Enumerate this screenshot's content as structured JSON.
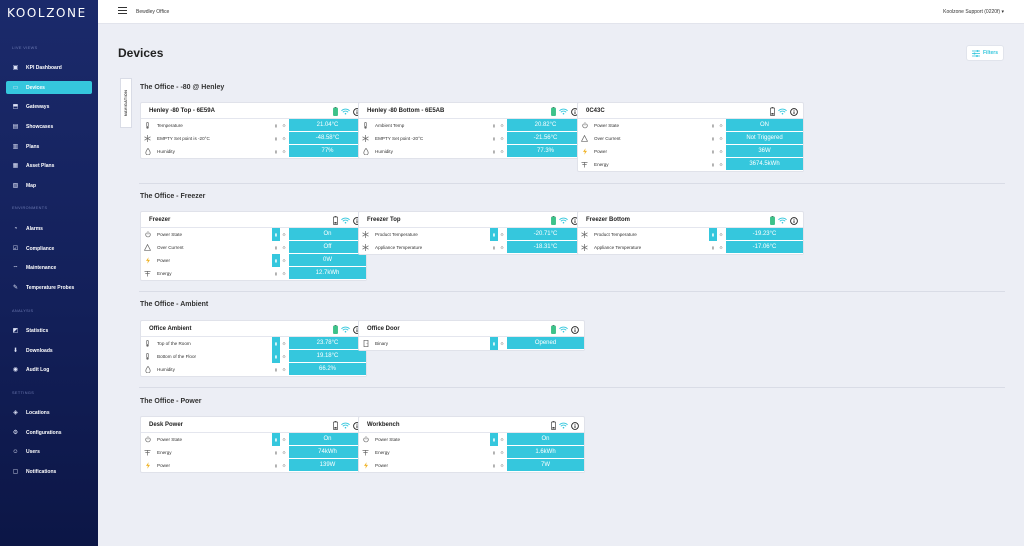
{
  "app": {
    "logo": "KOOLZONE"
  },
  "topbar": {
    "breadcrumb": "Bewdley Office",
    "user": "Koolzone Support (0220f)",
    "user_caret": "▾"
  },
  "sidebar": {
    "sections": {
      "live_views": "LIVE VIEWS",
      "environments": "ENVIRONMENTS",
      "analysis": "ANALYSIS",
      "settings": "SETTINGS"
    },
    "items": [
      {
        "label": "KPI Dashboard",
        "icon": "kpi-dashboard-icon",
        "glyph": "▣"
      },
      {
        "label": "Devices",
        "icon": "devices-icon",
        "glyph": "▭"
      },
      {
        "label": "Gateways",
        "icon": "gateway-icon",
        "glyph": "⬒"
      },
      {
        "label": "Showcases",
        "icon": "showcase-icon",
        "glyph": "▤"
      },
      {
        "label": "Plans",
        "icon": "plans-icon",
        "glyph": "▥"
      },
      {
        "label": "Asset Plans",
        "icon": "asset-plans-icon",
        "glyph": "▦"
      },
      {
        "label": "Map",
        "icon": "map-icon",
        "glyph": "▧"
      },
      {
        "label": "Alarms",
        "icon": "alarm-icon",
        "glyph": "◔"
      },
      {
        "label": "Compliance",
        "icon": "compliance-icon",
        "glyph": "☑"
      },
      {
        "label": "Maintenance",
        "icon": "maintenance-icon",
        "glyph": "⌔"
      },
      {
        "label": "Temperature Probes",
        "icon": "probe-icon",
        "glyph": "✎"
      },
      {
        "label": "Statistics",
        "icon": "statistics-icon",
        "glyph": "◩"
      },
      {
        "label": "Downloads",
        "icon": "download-icon",
        "glyph": "⬇"
      },
      {
        "label": "Audit Log",
        "icon": "audit-log-icon",
        "glyph": "◉"
      },
      {
        "label": "Locations",
        "icon": "location-icon",
        "glyph": "◈"
      },
      {
        "label": "Configurations",
        "icon": "configuration-icon",
        "glyph": "⚙"
      },
      {
        "label": "Users",
        "icon": "users-icon",
        "glyph": "☺"
      },
      {
        "label": "Notifications",
        "icon": "notification-icon",
        "glyph": "▢"
      }
    ]
  },
  "page": {
    "title": "Devices",
    "filters_label": "Filters",
    "navigation_tab": "NAVIGATION"
  },
  "groups": [
    {
      "title": "The Office - -80 @ Henley",
      "cards": [
        {
          "name": "Henley -80 Top - 6E59A",
          "battery": "full",
          "rows": [
            {
              "icon": "thermometer-icon",
              "label": "Temperature",
              "value": "21.04°C",
              "highlight": false
            },
            {
              "icon": "snowflake-icon",
              "label": "EMPTY Set point is -20°C",
              "value": "-48.58°C",
              "highlight": false
            },
            {
              "icon": "humidity-icon",
              "label": "Humidity",
              "value": "77%",
              "highlight": false
            }
          ]
        },
        {
          "name": "Henley -80 Bottom - 6E5AB",
          "battery": "full",
          "rows": [
            {
              "icon": "thermometer-icon",
              "label": "Ambient Temp",
              "value": "20.82°C",
              "highlight": false
            },
            {
              "icon": "snowflake-icon",
              "label": "EMPTY Set point -20°C",
              "value": "-21.56°C",
              "highlight": false
            },
            {
              "icon": "humidity-icon",
              "label": "Humidity",
              "value": "77.3%",
              "highlight": false
            }
          ]
        },
        {
          "name": "0C43C",
          "battery": "low",
          "rows": [
            {
              "icon": "power-state-icon",
              "label": "Power State",
              "value": "ON",
              "highlight": false
            },
            {
              "icon": "over-current-icon",
              "label": "Over Current",
              "value": "Not Triggered",
              "highlight": false
            },
            {
              "icon": "power-icon",
              "label": "Power",
              "value": "36W",
              "highlight": false
            },
            {
              "icon": "energy-icon",
              "label": "Energy",
              "value": "3674.5kWh",
              "highlight": false
            }
          ]
        }
      ]
    },
    {
      "title": "The Office - Freezer",
      "cards": [
        {
          "name": "Freezer",
          "battery": "low",
          "rows": [
            {
              "icon": "power-state-icon",
              "label": "Power State",
              "value": "On",
              "highlight": true
            },
            {
              "icon": "over-current-icon",
              "label": "Over Current",
              "value": "Off",
              "highlight": false
            },
            {
              "icon": "power-icon",
              "label": "Power",
              "value": "0W",
              "highlight": true
            },
            {
              "icon": "energy-icon",
              "label": "Energy",
              "value": "12.7kWh",
              "highlight": false
            }
          ]
        },
        {
          "name": "Freezer Top",
          "battery": "full",
          "rows": [
            {
              "icon": "snowflake-icon",
              "label": "Product Temperature",
              "value": "-20.71°C",
              "highlight": true
            },
            {
              "icon": "snowflake-icon",
              "label": "Appliance Temperature",
              "value": "-18.31°C",
              "highlight": false
            }
          ]
        },
        {
          "name": "Freezer Bottom",
          "battery": "full",
          "rows": [
            {
              "icon": "snowflake-icon",
              "label": "Product Temperature",
              "value": "-19.23°C",
              "highlight": true
            },
            {
              "icon": "snowflake-icon",
              "label": "Appliance Temperature",
              "value": "-17.06°C",
              "highlight": false
            }
          ]
        }
      ]
    },
    {
      "title": "The Office - Ambient",
      "cards": [
        {
          "name": "Office Ambient",
          "battery": "full",
          "rows": [
            {
              "icon": "thermometer-icon",
              "label": "Top of the Room",
              "value": "23.78°C",
              "highlight": true
            },
            {
              "icon": "thermometer-icon",
              "label": "Bottom of the Floor",
              "value": "19.18°C",
              "highlight": true
            },
            {
              "icon": "humidity-icon",
              "label": "Humidity",
              "value": "66.2%",
              "highlight": false
            }
          ]
        },
        {
          "name": "Office Door",
          "battery": "full",
          "rows": [
            {
              "icon": "door-icon",
              "label": "Binary",
              "value": "Opened",
              "highlight": true
            }
          ]
        }
      ]
    },
    {
      "title": "The Office - Power",
      "cards": [
        {
          "name": "Desk Power",
          "battery": "low",
          "rows": [
            {
              "icon": "power-state-icon",
              "label": "Power State",
              "value": "On",
              "highlight": true
            },
            {
              "icon": "energy-icon",
              "label": "Energy",
              "value": "74kWh",
              "highlight": false
            },
            {
              "icon": "power-icon",
              "label": "Power",
              "value": "139W",
              "highlight": false
            }
          ]
        },
        {
          "name": "Workbench",
          "battery": "low",
          "rows": [
            {
              "icon": "power-state-icon",
              "label": "Power State",
              "value": "On",
              "highlight": true
            },
            {
              "icon": "energy-icon",
              "label": "Energy",
              "value": "1.6kWh",
              "highlight": false
            },
            {
              "icon": "power-icon",
              "label": "Power",
              "value": "7W",
              "highlight": false
            }
          ]
        }
      ]
    }
  ],
  "colors": {
    "accent": "#35c7dd",
    "sidebar": "#13205a",
    "battery_full": "#3ec28a"
  }
}
